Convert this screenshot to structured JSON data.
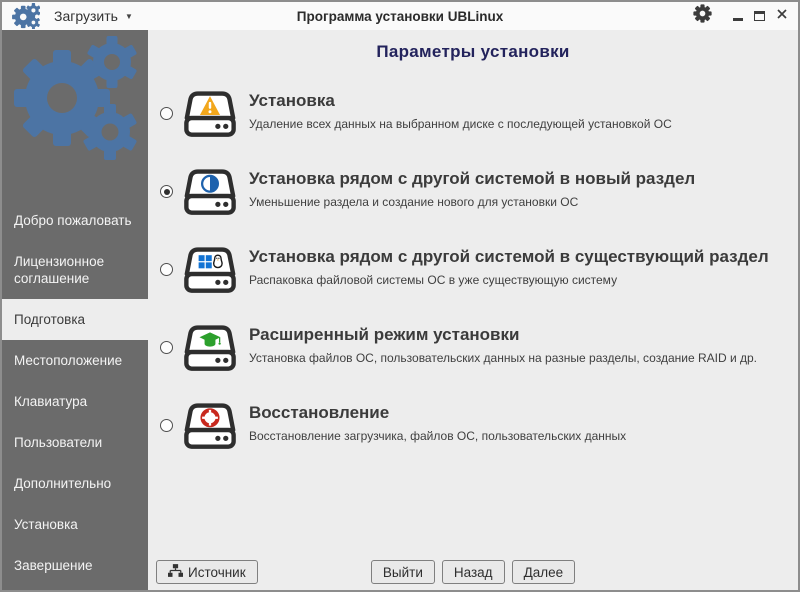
{
  "titlebar": {
    "menu_label": "Загрузить",
    "title": "Программа установки UBLinux"
  },
  "sidebar": {
    "active_item": "Подготовка",
    "items": [
      "Добро пожаловать",
      "Лицензионное соглашение",
      "Подготовка",
      "Местоположение",
      "Клавиатура",
      "Пользователи",
      "Дополнительно",
      "Установка",
      "Завершение"
    ]
  },
  "main": {
    "heading": "Параметры установки",
    "options": [
      {
        "title": "Установка",
        "description": "Удаление всех данных на выбранном диске с последующей установкой ОС",
        "icon": "drive-warning-icon",
        "selected": false
      },
      {
        "title": "Установка рядом с другой системой в новый раздел",
        "description": "Уменьшение раздела и создание нового для установки ОС",
        "icon": "drive-partition-icon",
        "selected": true
      },
      {
        "title": "Установка рядом с другой системой в существующий раздел",
        "description": "Распаковка файловой системы ОС в уже существующую систему",
        "icon": "drive-dualboot-icon",
        "selected": false
      },
      {
        "title": "Расширенный режим установки",
        "description": "Установка файлов ОС, пользовательских данных на разные разделы, создание RAID и др.",
        "icon": "drive-advanced-icon",
        "selected": false
      },
      {
        "title": "Восстановление",
        "description": "Восстановление загрузчика, файлов ОС, пользовательских данных",
        "icon": "drive-recovery-icon",
        "selected": false
      }
    ]
  },
  "footer": {
    "source_label": "Источник",
    "exit_label": "Выйти",
    "back_label": "Назад",
    "next_label": "Далее"
  },
  "colors": {
    "accent_blue": "#4c74a4",
    "sidebar_bg": "#6b6b6b",
    "content_bg": "#ededed",
    "heading_navy": "#23235c",
    "warning_orange": "#f2a71c",
    "partition_blue": "#1e62ad",
    "windows_blue": "#1173d4",
    "advanced_green": "#2ca02c",
    "recovery_red": "#c8281e"
  }
}
